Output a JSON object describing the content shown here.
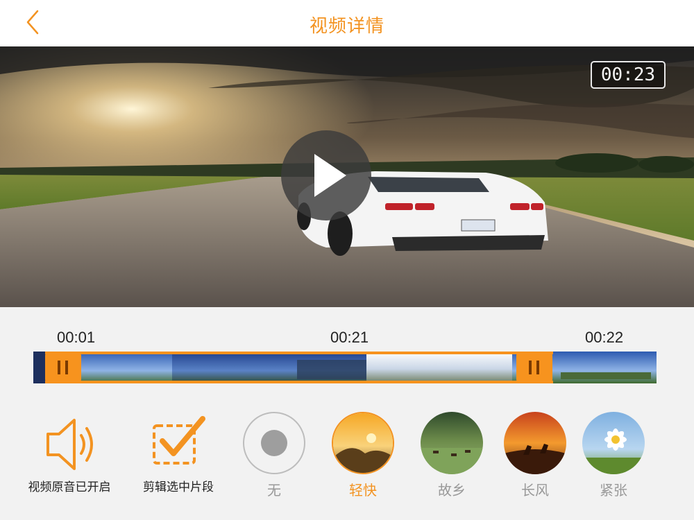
{
  "header": {
    "title": "视频详情",
    "back_icon": "chevron-left-icon",
    "accent": "#f39321"
  },
  "video": {
    "duration": "00:23",
    "play_icon": "play-icon"
  },
  "timeline": {
    "start_time": "00:01",
    "mid_time": "00:21",
    "end_time": "00:22",
    "handle_color": "#f7931e"
  },
  "tools": {
    "audio_label": "视频原音已开启",
    "audio_icon": "speaker-icon",
    "clip_label": "剪辑选中片段",
    "clip_icon": "checkbox-checked-icon"
  },
  "music": [
    {
      "name": "无",
      "selected": false
    },
    {
      "name": "轻快",
      "selected": true
    },
    {
      "name": "故乡",
      "selected": false
    },
    {
      "name": "长风",
      "selected": false
    },
    {
      "name": "紧张",
      "selected": false
    }
  ]
}
